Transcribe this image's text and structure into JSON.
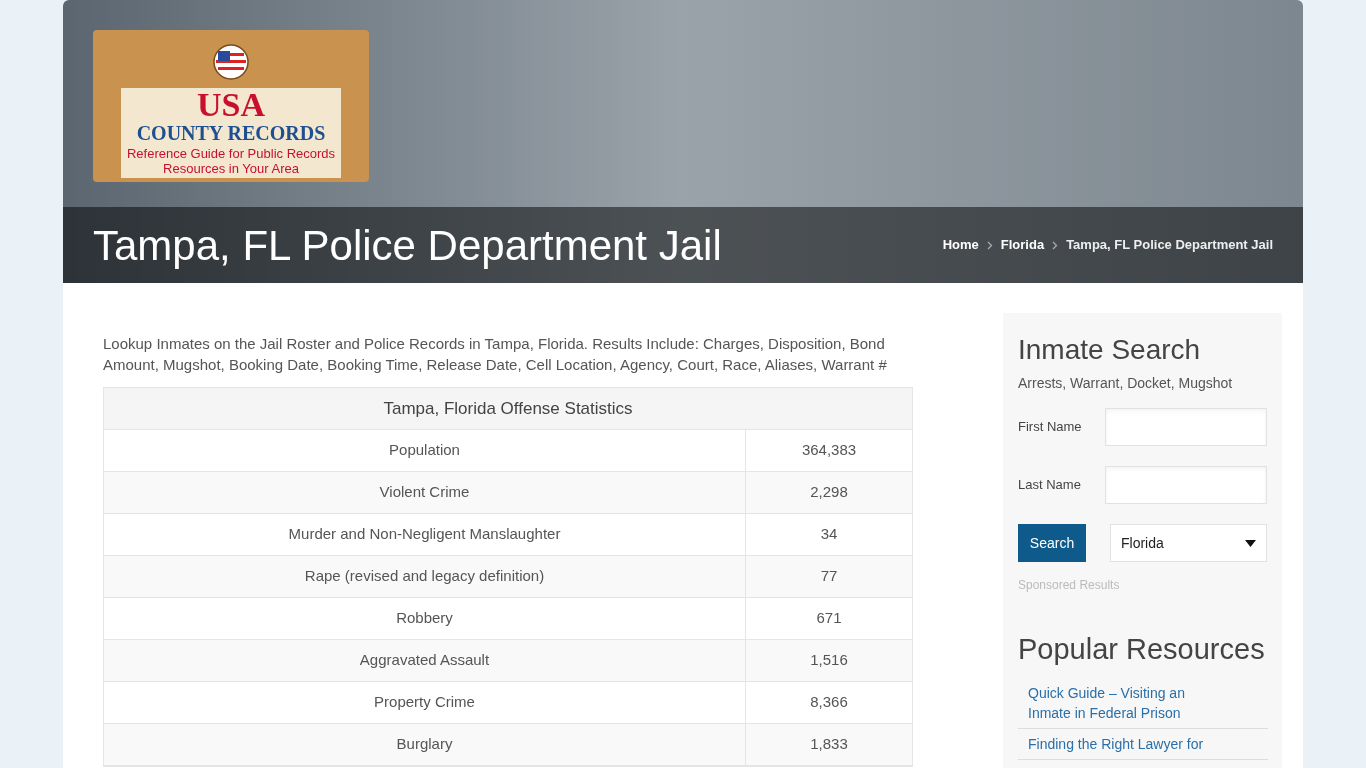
{
  "logo": {
    "title": "USA",
    "subtitle": "COUNTY RECORDS",
    "tagline": "Reference Guide for Public Records Resources in Your Area"
  },
  "page_title": "Tampa, FL Police Department Jail",
  "breadcrumb": [
    {
      "label": "Home",
      "current": false
    },
    {
      "label": "Florida",
      "current": false
    },
    {
      "label": "Tampa, FL Police Department Jail",
      "current": true
    }
  ],
  "intro": "Lookup Inmates on the Jail Roster and Police Records in Tampa, Florida. Results Include: Charges, Disposition, Bond Amount, Mugshot, Booking Date, Booking Time, Release Date, Cell Location, Agency, Court, Race, Aliases, Warrant #",
  "table": {
    "title": "Tampa, Florida Offense Statistics",
    "rows": [
      [
        "Population",
        "364,383"
      ],
      [
        "Violent Crime",
        "2,298"
      ],
      [
        "Murder and Non-Negligent Manslaughter",
        "34"
      ],
      [
        "Rape (revised and legacy definition)",
        "77"
      ],
      [
        "Robbery",
        "671"
      ],
      [
        "Aggravated Assault",
        "1,516"
      ],
      [
        "Property Crime",
        "8,366"
      ],
      [
        "Burglary",
        "1,833"
      ]
    ]
  },
  "inmate_search": {
    "title": "Inmate Search",
    "subtitle": "Arrests, Warrant, Docket, Mugshot",
    "fields": [
      {
        "label": "First Name"
      },
      {
        "label": "Last Name"
      }
    ],
    "button": "Search",
    "state": "Florida",
    "sponsored": "Sponsored Results"
  },
  "popular": {
    "title": "Popular Resources",
    "links": [
      "Quick Guide – Visiting an Inmate in Federal Prison",
      "Finding the Right Lawyer for"
    ]
  }
}
